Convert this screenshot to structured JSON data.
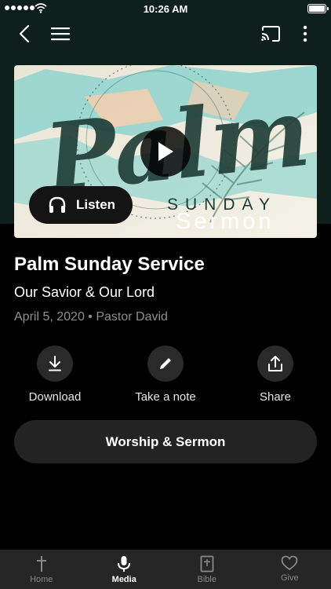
{
  "status_bar": {
    "time": "10:26 AM"
  },
  "nav": {
    "back_icon": "chevron-left-icon",
    "menu_icon": "hamburger-icon",
    "cast_icon": "cast-icon",
    "more_icon": "vertical-dots-icon"
  },
  "media": {
    "artwork_text": {
      "script": "Palm",
      "sunday": "SUNDAY",
      "sermon": "Sermon"
    },
    "play_icon": "play-icon",
    "listen_label": "Listen"
  },
  "sermon": {
    "title": "Palm Sunday Service",
    "subtitle": "Our Savior & Our Lord",
    "date": "April 5, 2020",
    "separator": "•",
    "speaker": "Pastor David"
  },
  "actions": [
    {
      "label": "Download",
      "icon": "download-icon"
    },
    {
      "label": "Take a note",
      "icon": "pencil-icon"
    },
    {
      "label": "Share",
      "icon": "share-icon"
    }
  ],
  "worship_button": "Worship & Sermon",
  "tabs": [
    {
      "label": "Home",
      "icon": "cross-icon",
      "active": false
    },
    {
      "label": "Media",
      "icon": "microphone-icon",
      "active": true
    },
    {
      "label": "Bible",
      "icon": "bible-icon",
      "active": false
    },
    {
      "label": "Give",
      "icon": "heart-icon",
      "active": false
    }
  ],
  "colors": {
    "background": "#000000",
    "header": "#0f1f1b",
    "muted_text": "#8e8e8e",
    "button_bg": "#232323",
    "tab_bar": "#262626",
    "artwork_teal": "#8fd3cc",
    "artwork_peach": "#f2cfb0"
  }
}
